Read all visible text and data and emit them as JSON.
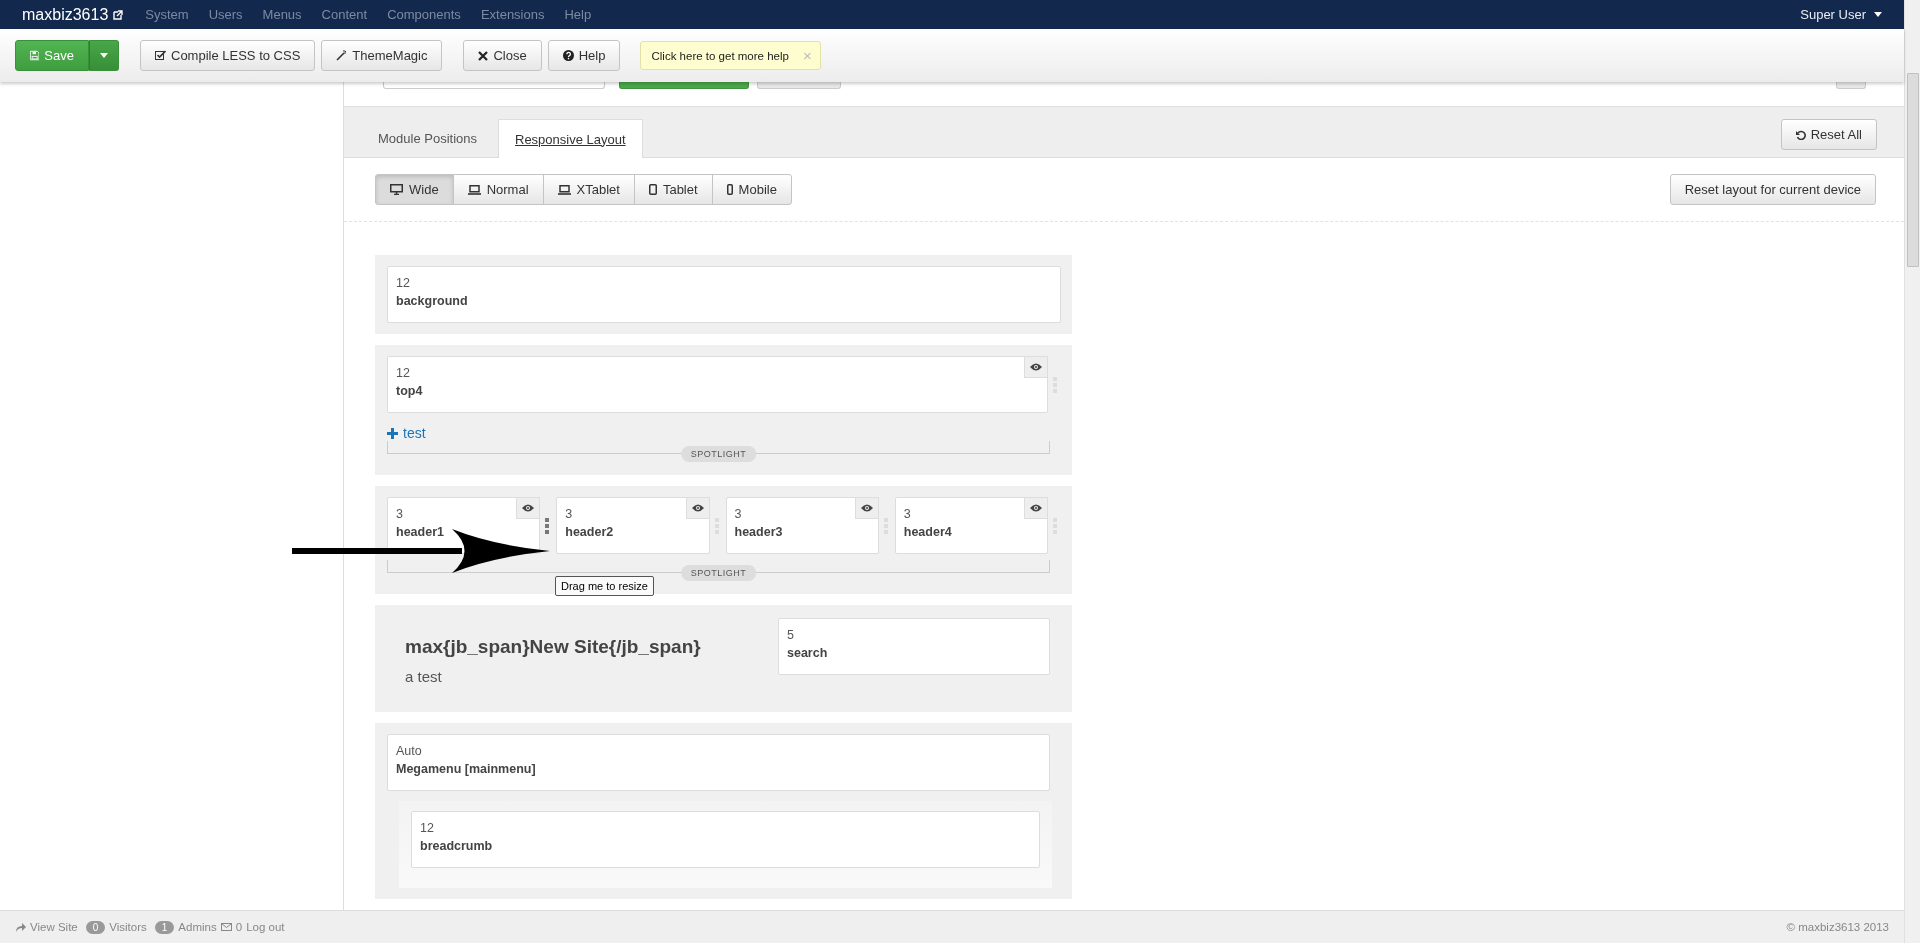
{
  "navbar": {
    "site": "maxbiz3613",
    "menus": [
      "System",
      "Users",
      "Menus",
      "Content",
      "Components",
      "Extensions",
      "Help"
    ],
    "user": "Super User"
  },
  "toolbar": {
    "buttons": [
      {
        "label": "Save",
        "kind": "save"
      },
      {
        "label": "Compile LESS to CSS",
        "kind": "compile"
      },
      {
        "label": "ThemeMagic",
        "kind": "magic"
      },
      {
        "label": "Close",
        "kind": "close"
      },
      {
        "label": "Help",
        "kind": "help"
      }
    ],
    "help_tip": {
      "text": "Click here to get more help",
      "close": "×"
    }
  },
  "tabs": [
    {
      "label": "Module Positions",
      "selected": false
    },
    {
      "label": "Responsive Layout",
      "selected": true
    }
  ],
  "reset_all": "Reset All",
  "devices": [
    {
      "label": "Wide",
      "kind": "desktop",
      "selected": true
    },
    {
      "label": "Normal",
      "kind": "laptop",
      "selected": false
    },
    {
      "label": "XTablet",
      "kind": "laptop",
      "selected": false
    },
    {
      "label": "Tablet",
      "kind": "tablet",
      "selected": false
    },
    {
      "label": "Mobile",
      "kind": "mobile",
      "selected": false
    }
  ],
  "reset_device": "Reset layout for current device",
  "sections": [
    {
      "kind": "row",
      "modules": [
        {
          "span": "12",
          "name": "background",
          "hideable": false
        }
      ]
    },
    {
      "kind": "spotlight",
      "label": "SPOTLIGHT",
      "add_link": "test",
      "modules": [
        {
          "span": "12",
          "name": "top4",
          "hideable": true,
          "handle_active": false
        }
      ]
    },
    {
      "kind": "spotlight",
      "label": "SPOTLIGHT",
      "modules": [
        {
          "span": "3",
          "name": "header1",
          "hideable": true,
          "handle_active": true
        },
        {
          "span": "3",
          "name": "header2",
          "hideable": true,
          "handle_active": false
        },
        {
          "span": "3",
          "name": "header3",
          "hideable": true,
          "handle_active": false
        },
        {
          "span": "3",
          "name": "header4",
          "hideable": true,
          "handle_active": false
        }
      ]
    },
    {
      "kind": "header",
      "title": "max{jb_span}New Site{/jb_span}",
      "tagline": "a test",
      "modules": [
        {
          "span": "5",
          "name": "search"
        }
      ]
    },
    {
      "kind": "nested",
      "modules": [
        {
          "span": "Auto",
          "name": "Megamenu [mainmenu]"
        }
      ],
      "children": [
        {
          "span": "12",
          "name": "breadcrumb"
        }
      ]
    }
  ],
  "tooltip": "Drag me to resize",
  "status_bar": {
    "view_site": "View Site",
    "visitors_count": "0",
    "visitors": "Visitors",
    "admins_count": "1",
    "admins": "Admins",
    "messages": "0",
    "logout": "Log out",
    "copyright": "© maxbiz3613 2013"
  }
}
